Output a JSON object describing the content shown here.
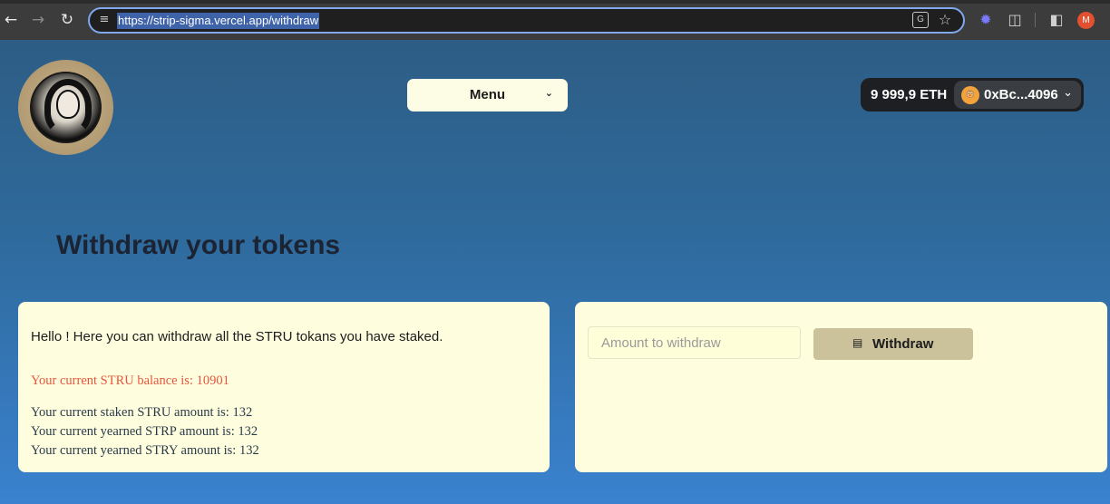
{
  "browser": {
    "url": "https://strip-sigma.vercel.app/withdraw",
    "profile_initial": "M",
    "translate_glyph": "G"
  },
  "header": {
    "menu_label": "Menu",
    "wallet_balance": "9 999,9 ETH",
    "wallet_address": "0xBc...4096",
    "avatar_glyph": "🐵"
  },
  "main": {
    "title": "Withdraw your tokens",
    "intro": "Hello ! Here you can withdraw all the STRU tokans you have staked.",
    "balance_line": "Your current STRU balance is: 10901",
    "staked_line": "Your current staken STRU amount is: 132",
    "strp_line": "Your current yearned STRP amount is: 132",
    "stry_line": "Your current yearned STRY amount is: 132",
    "amount_placeholder": "Amount to withdraw",
    "amount_value": "",
    "withdraw_label": "Withdraw"
  },
  "icons": {
    "back": "back-arrow-icon",
    "forward": "forward-arrow-icon",
    "reload": "reload-icon",
    "site_settings": "tune-icon",
    "translate": "translate-icon",
    "bookmark": "star-icon",
    "extension_gear": "gear-icon",
    "extensions": "puzzle-icon",
    "side_panel": "side-panel-icon",
    "withdraw": "money-icon"
  },
  "colors": {
    "accent_red": "#e7553e",
    "card_bg": "#fefede",
    "button_bg": "#cbc29c",
    "wallet_bg": "#1d1f22"
  }
}
